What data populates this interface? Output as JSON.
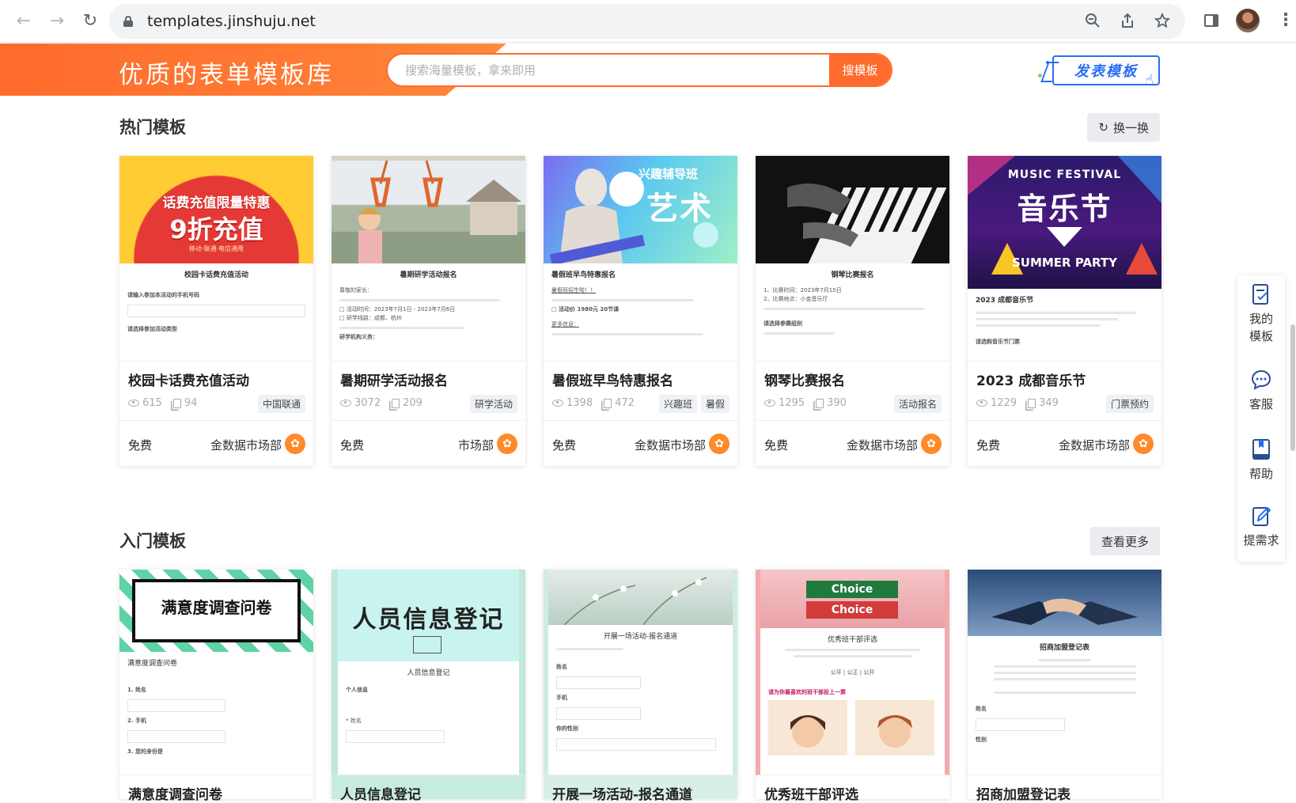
{
  "browser": {
    "url": "templates.jinshuju.net"
  },
  "banner": {
    "title": "优质的表单模板库",
    "search_placeholder": "搜索海量模板，拿来即用",
    "search_button": "搜模板",
    "publish_label": "发表模板"
  },
  "hot": {
    "title": "热门模板",
    "action": "换一换",
    "cards": [
      {
        "title": "校园卡话费充值活动",
        "views": "615",
        "copies": "94",
        "tags": [
          "中国联通"
        ],
        "price": "免费",
        "author": "金数据市场部",
        "banner_line1": "话费充值限量特惠",
        "banner_line2": "9折充值",
        "banner_sub": "移动·联通·电信通用",
        "form_title": "校园卡话费充值活动",
        "form_q1": "请输入参加本活动的手机号码",
        "form_q2": "请选择参加活动类型"
      },
      {
        "title": "暑期研学活动报名",
        "views": "3072",
        "copies": "209",
        "tags": [
          "研学活动"
        ],
        "price": "免费",
        "author": "市场部",
        "form_title": "暑期研学活动报名",
        "form_l1": "尊敬的家长：",
        "form_l2": "□ 活动时间：2023年7月1日 - 2023年7月6日",
        "form_l3": "□ 研学线路：成都、杭州",
        "form_l4": "研学机构义务："
      },
      {
        "title": "暑假班早鸟特惠报名",
        "views": "1398",
        "copies": "472",
        "tags": [
          "兴趣班",
          "暑假"
        ],
        "price": "免费",
        "author": "金数据市场部",
        "banner_line1": "兴趣辅导班",
        "banner_line2": "艺术",
        "form_title": "暑假班早鸟特惠报名",
        "form_l1": "暑假班招生啦！！",
        "form_l2": "□ 活动价 1980元 20节课",
        "form_l3": "更多信息："
      },
      {
        "title": "钢琴比赛报名",
        "views": "1295",
        "copies": "390",
        "tags": [
          "活动报名"
        ],
        "price": "免费",
        "author": "金数据市场部",
        "form_title": "钢琴比赛报名",
        "form_l1": "1、比赛时间：2023年7月15日",
        "form_l2": "2、比赛地点：小金音乐厅",
        "form_l3": "请选择参赛组别"
      },
      {
        "title": "2023 成都音乐节",
        "views": "1229",
        "copies": "349",
        "tags": [
          "门票预约"
        ],
        "price": "免费",
        "author": "金数据市场部",
        "banner_line1": "MUSIC FESTIVAL",
        "banner_line2": "音乐节",
        "banner_sub": "SUMMER PARTY",
        "form_title": "2023 成都音乐节",
        "form_l1": "请选购音乐节门票"
      }
    ]
  },
  "intro": {
    "title": "入门模板",
    "action": "查看更多",
    "cards": [
      {
        "title": "满意度调查问卷",
        "thumb_title": "满意度调查问卷",
        "form_title": "满意度调查问卷",
        "q1": "1. 姓名",
        "q2": "2. 手机",
        "q3": "3. 您的身份是"
      },
      {
        "title": "人员信息登记",
        "thumb_title": "人员信息登记",
        "form_title": "人员信息登记",
        "q1": "个人信息",
        "q2": "* 姓名"
      },
      {
        "title": "开展一场活动-报名通道",
        "form_title": "开展一场活动-报名通道",
        "q1": "姓名",
        "q2": "手机",
        "q3": "你的性别"
      },
      {
        "title": "优秀班干部评选",
        "thumb_title": "Choice",
        "form_title": "优秀班干部评选",
        "q1": "公平 | 公正 | 公开",
        "q2": "请为你最喜欢的班干部投上一票"
      },
      {
        "title": "招商加盟登记表",
        "form_title": "招商加盟登记表",
        "q1": "姓名",
        "q2": "性别"
      }
    ]
  },
  "float_bar": {
    "my_templates": "我的模板",
    "service": "客服",
    "help": "帮助",
    "request": "提需求"
  }
}
